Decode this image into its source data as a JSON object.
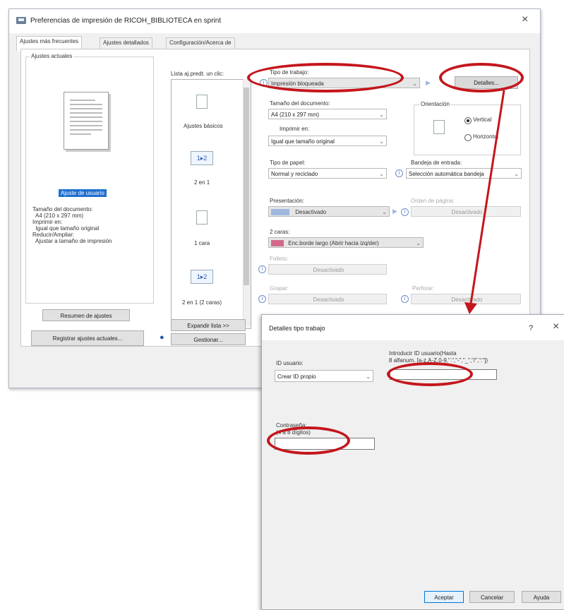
{
  "main_dialog": {
    "title": "Preferencias de impresión de RICOH_BIBLIOTECA en sprint",
    "tabs": [
      "Ajustes más frecuentes",
      "Ajustes detallados",
      "Configuración/Acerca de"
    ],
    "current_settings": {
      "group_label": "Ajustes actuales",
      "selected_label": "Ajuste de usuario",
      "summary_lines": [
        "Tamaño del documento:",
        "  A4 (210 x 297 mm)",
        "Imprimir en:",
        "  Igual que tamaño original",
        "Reducir/Ampliar:",
        "  Ajustar a tamaño de impresión"
      ],
      "summary_button": "Resumen de ajustes",
      "register_button": "Registrar ajustes actuales..."
    },
    "favorites": {
      "label": "Lista aj.predt. un clic:",
      "items": [
        "Ajustes básicos",
        "2 en 1",
        "1 cara",
        "2 en 1 (2 caras)"
      ],
      "twoup_glyph": "1▸2",
      "expand_button": "Expandir lista >>",
      "manage_button": "Gestionar..."
    },
    "job_type": {
      "label": "Tipo de trabajo:",
      "value": "Impresión bloqueada",
      "details_button": "Detalles..."
    },
    "document_size": {
      "label": "Tamaño del documento:",
      "value": "A4 (210 x 297 mm)"
    },
    "print_on": {
      "label": "Imprimir en:",
      "value": "Igual que tamaño original"
    },
    "orientation": {
      "label": "Orientación",
      "vertical": "Vertical",
      "horizontal": "Horizontal",
      "selected": "Vertical"
    },
    "paper_type": {
      "label": "Tipo de papel:",
      "value": "Normal y reciclado"
    },
    "input_tray": {
      "label": "Bandeja de entrada:",
      "value": "Selección automática bandeja"
    },
    "layout": {
      "label": "Presentación:",
      "value": "Desactivado"
    },
    "page_order": {
      "label": "Orden de página:",
      "value": "Desactivado"
    },
    "duplex": {
      "label": "2 caras:",
      "value": "Enc.borde largo (Abrir hacia izq/der)"
    },
    "booklet": {
      "label": "Folleto:",
      "value": "Desactivado"
    },
    "staple": {
      "label": "Grapar:",
      "value": "Desactivado"
    },
    "punch": {
      "label": "Perforar:",
      "value": "Desactivado"
    }
  },
  "details_dialog": {
    "title": "Detalles tipo trabajo",
    "help_glyph": "?",
    "user_id": {
      "label": "ID usuario:",
      "value": "Crear ID propio"
    },
    "user_id_entry": {
      "label": "Introducir ID usuario(Hasta",
      "hint": "8 alfanum. [a-z,A-Z,0-9,\".\",\"-\",\"_\",\"/\",\":\"])",
      "value": ""
    },
    "password": {
      "label": "Contraseña:",
      "hint": "(4 a 8 dígitos)",
      "value": ""
    },
    "buttons": {
      "ok": "Aceptar",
      "cancel": "Cancelar",
      "help": "Ayuda"
    }
  },
  "icons": {
    "close": "×",
    "dropdown": "⌄",
    "info": "ⓘ",
    "arrow_right": "▶",
    "user": "person-icon"
  },
  "colors": {
    "annotation_red": "#c4161c",
    "selection_blue": "#1f6fd0",
    "focus_blue": "#0078d7"
  }
}
